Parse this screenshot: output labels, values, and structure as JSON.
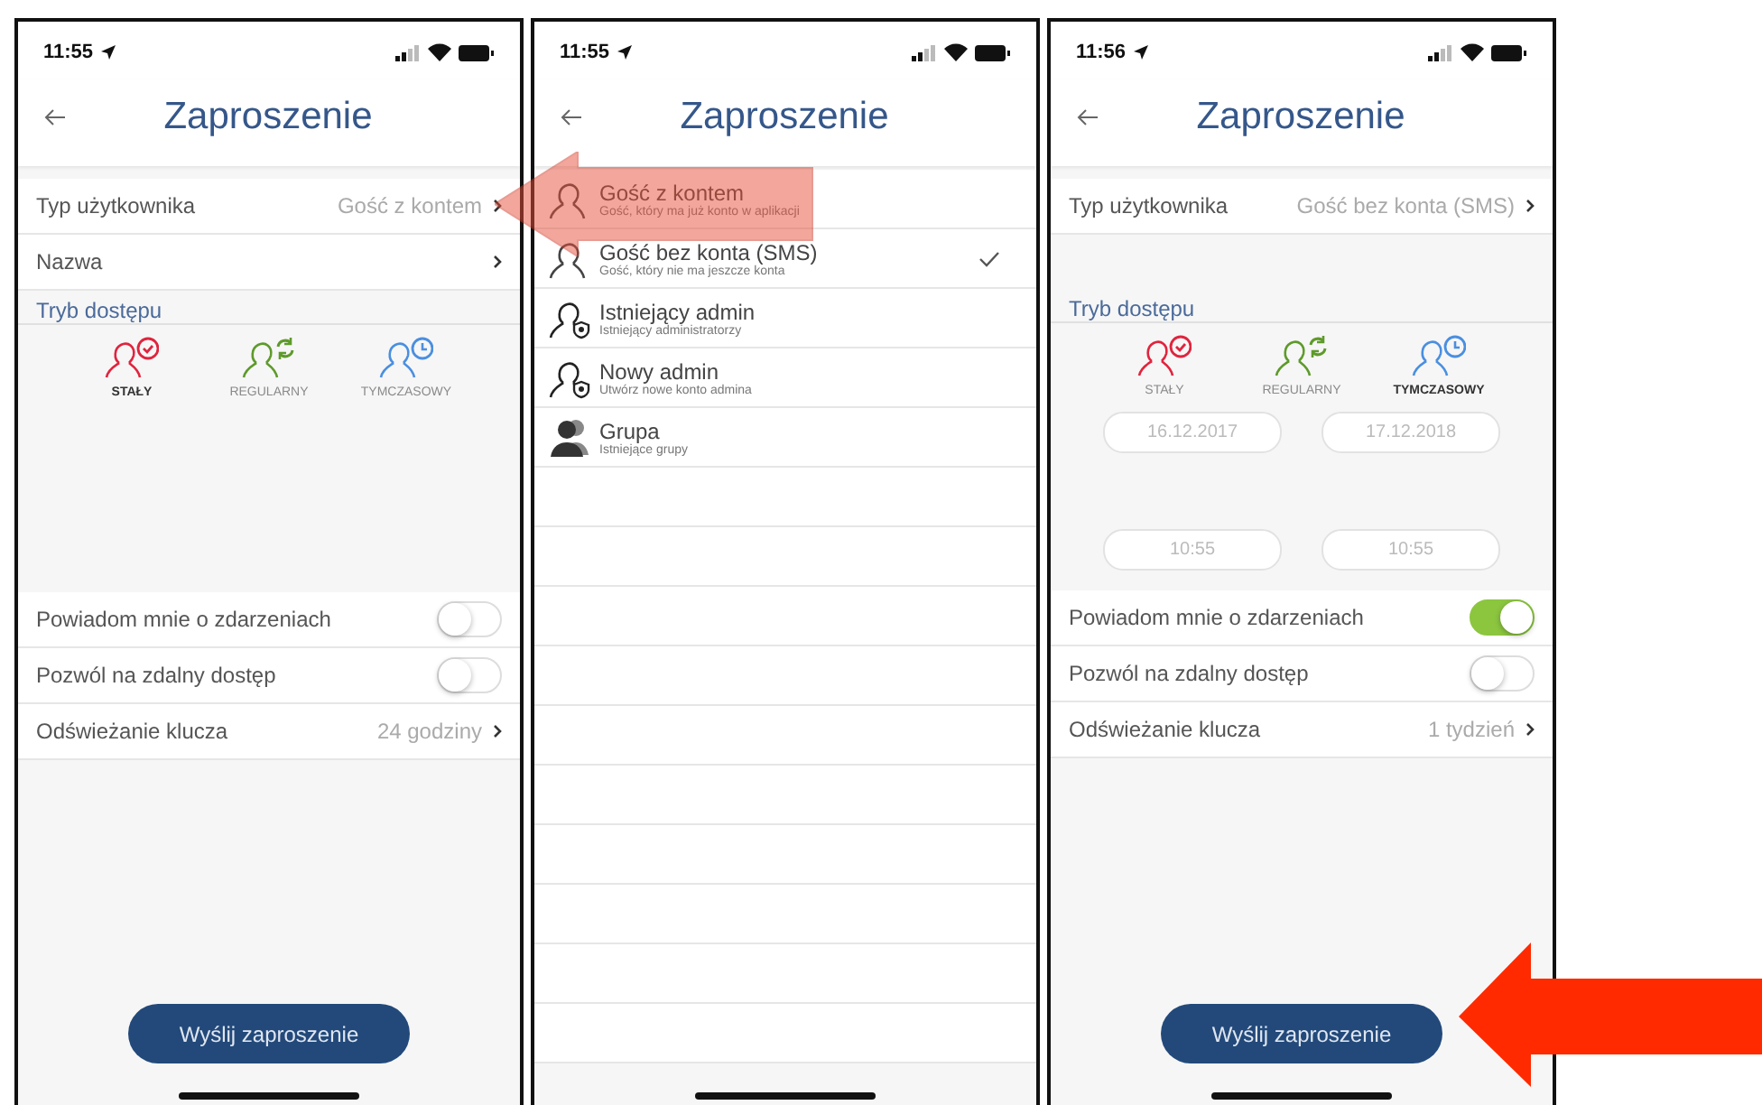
{
  "screens": [
    {
      "kind": "form",
      "status_bar": {
        "time": "11:55"
      },
      "title": "Zaproszenie",
      "rows": [
        {
          "label": "Typ użytkownika",
          "value": "Gość z kontem"
        },
        {
          "label": "Nazwa"
        }
      ],
      "section": "Tryb dostępu",
      "modes": [
        {
          "label": "STAŁY",
          "selected": true,
          "color": "#e0243e",
          "kind": "check"
        },
        {
          "label": "REGULARNY",
          "selected": false,
          "color": "#5e9a2a",
          "kind": "repeat"
        },
        {
          "label": "TYMCZASOWY",
          "selected": false,
          "color": "#4a8fe0",
          "kind": "clock"
        }
      ],
      "toggles": [
        {
          "label": "Powiadom mnie o zdarzeniach",
          "on": false
        },
        {
          "label": "Pozwól na zdalny dostęp",
          "on": false
        }
      ],
      "key_refresh": {
        "label": "Odświeżanie klucza",
        "value": "24 godziny"
      },
      "button": "Wyślij zaproszenie"
    },
    {
      "kind": "list",
      "status_bar": {
        "time": "11:55"
      },
      "title": "Zaproszenie",
      "options": [
        {
          "kind": "person",
          "title": "Gość z kontem",
          "subtitle": "Gość, który ma już konto w aplikacji",
          "selected": false
        },
        {
          "kind": "person",
          "title": "Gość bez konta (SMS)",
          "subtitle": "Gość, który nie ma jeszcze konta",
          "selected": true
        },
        {
          "kind": "admin",
          "title": "Istniejący admin",
          "subtitle": "Istniejący administratorzy",
          "selected": false
        },
        {
          "kind": "admin",
          "title": "Nowy admin",
          "subtitle": "Utwórz nowe konto admina",
          "selected": false
        },
        {
          "kind": "group",
          "title": "Grupa",
          "subtitle": "Istniejące grupy",
          "selected": false
        }
      ]
    },
    {
      "kind": "form",
      "status_bar": {
        "time": "11:56"
      },
      "title": "Zaproszenie",
      "rows": [
        {
          "label": "Typ użytkownika",
          "value": "Gość bez konta (SMS)"
        }
      ],
      "section": "Tryb dostępu",
      "modes": [
        {
          "label": "STAŁY",
          "selected": false,
          "color": "#e0243e",
          "kind": "check"
        },
        {
          "label": "REGULARNY",
          "selected": false,
          "color": "#5e9a2a",
          "kind": "repeat"
        },
        {
          "label": "TYMCZASOWY",
          "selected": true,
          "color": "#4a8fe0",
          "kind": "clock"
        }
      ],
      "dates": [
        "16.12.2017",
        "17.12.2018"
      ],
      "times": [
        "10:55",
        "10:55"
      ],
      "toggles": [
        {
          "label": "Powiadom mnie o zdarzeniach",
          "on": true
        },
        {
          "label": "Pozwól na zdalny dostęp",
          "on": false
        }
      ],
      "key_refresh": {
        "label": "Odświeżanie klucza",
        "value": "1 tydzień"
      },
      "button": "Wyślij zaproszenie"
    }
  ]
}
